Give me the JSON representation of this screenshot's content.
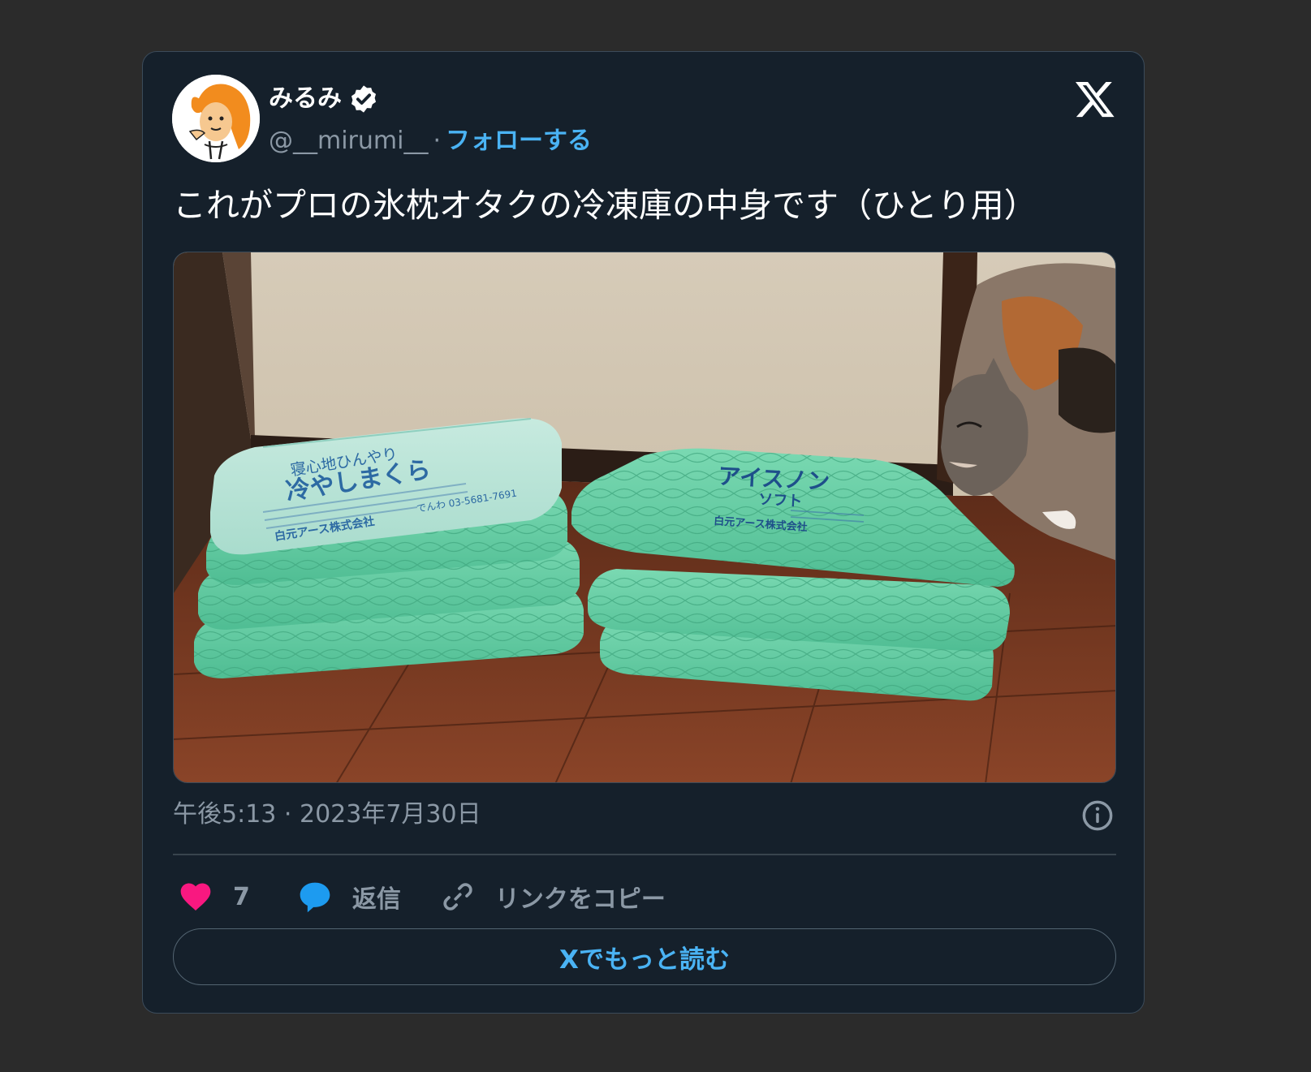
{
  "author": {
    "display_name": "みるみ",
    "handle": "@__mirumi__",
    "verified": true,
    "separator": "·",
    "follow_label": "フォローする"
  },
  "tweet": {
    "text": "これがプロの氷枕オタクの冷凍庫の中身です（ひとり用）",
    "timestamp": "午後5:13 · 2023年7月30日"
  },
  "actions": {
    "like_count": "7",
    "reply_label": "返信",
    "copy_link_label": "リンクをコピー"
  },
  "read_more_label": "Xでもっと読む",
  "photo": {
    "left_pillow_text": "冷やしまくら",
    "left_pillow_subtext": "寝心地ひんやり",
    "left_pillow_maker": "白元アース株式会社",
    "left_pillow_phone": "でんわ 03-5681-7691",
    "right_pillow_text": "アイスノン",
    "right_pillow_subtext": "ソフト",
    "right_pillow_maker": "白元アース株式会社"
  },
  "icons": {
    "logo": "x-logo-icon",
    "verified": "verified-badge-icon",
    "like": "heart-icon",
    "reply": "speech-bubble-icon",
    "copy": "link-icon",
    "info": "info-icon"
  },
  "colors": {
    "card_bg": "#15202b",
    "page_bg": "#2b2b2b",
    "accent": "#4ab3f4",
    "like": "#f91880",
    "reply": "#1d9bf0",
    "muted": "#8b98a5"
  }
}
